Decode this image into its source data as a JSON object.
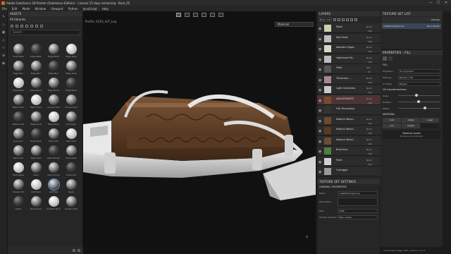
{
  "titlebar": {
    "title": "Adobe Substance 3D Painter (Substance Edition) - License 15 days remaining - Boat_02",
    "minimize": "—",
    "maximize": "☐",
    "close": "✕"
  },
  "menu": [
    "File",
    "Edit",
    "Mode",
    "Window",
    "Viewport",
    "Python",
    "JavaScript",
    "Help"
  ],
  "assets": {
    "panel_title": "ASSETS",
    "library": "All libraries",
    "search_placeholder": "Search",
    "items": [
      "Dust Wide",
      "Edge Bolts",
      "Edge Bolts",
      "Edge Rust",
      "Edge Blur",
      "Edge Blur",
      "Edge Blur",
      "Edge Rust",
      "Edge Bolts",
      "Edge Burnt",
      "Edge Burnt",
      "Edge Bolts",
      "Fabric Thre",
      "Fabric Thre",
      "Ground Dirt",
      "Ground Dirt",
      "Metal Dust",
      "Metal Dust",
      "Moss Sand",
      "Occlusion",
      "Occlusion",
      "Paint Spot",
      "Paint Dirt",
      "Paint Dirt",
      "Paint Dirt",
      "Paint Dirt",
      "Paint Rough",
      "Rust Wide",
      "Sand Wide",
      "Sand",
      "Sand Curve",
      "Scratches",
      "Shape Dirt",
      "Soft Dam",
      "Soft Bed",
      "Spots",
      "Spots",
      "Stone Rock",
      "Surface Rock",
      "Surface Rust",
      "Sand 2D",
      "Water Stain",
      "",
      ""
    ]
  },
  "viewport": {
    "profile": "Profile: ACES_LUT_Log",
    "mode": "Material",
    "axis": "Y"
  },
  "layers": {
    "panel_title": "LAYERS",
    "channel": "Base color",
    "rows": [
      {
        "name": "Mask",
        "blend": "Norm",
        "opacity": "100"
      },
      {
        "name": "Nail Glow",
        "blend": "Norm",
        "opacity": "100"
      },
      {
        "name": "Wooden Edges",
        "blend": "Norm",
        "opacity": "100"
      },
      {
        "name": "Lightened Ed...",
        "blend": "Norm",
        "opacity": "100"
      },
      {
        "name": "Filter",
        "blend": "Mul",
        "opacity": "15"
      },
      {
        "name": "Thickness ...",
        "blend": "Norm",
        "opacity": "100"
      },
      {
        "name": "Light Scratches",
        "blend": "Norm",
        "opacity": "100"
      },
      {
        "name": "ADJUSTMENTS",
        "blend": "Norm",
        "opacity": "100"
      },
      {
        "name": "HSL Perceptive",
        "blend": "",
        "opacity": ""
      },
      {
        "name": "Natural Wood...",
        "blend": "Norm",
        "opacity": "100"
      },
      {
        "name": "Natural Wood...",
        "blend": "Norm",
        "opacity": "100"
      },
      {
        "name": "Natural Wood...",
        "blend": "Norm",
        "opacity": "100"
      },
      {
        "name": "Branches",
        "blend": "Norm",
        "opacity": "100"
      },
      {
        "name": "Paint",
        "blend": "Norm",
        "opacity": "100"
      },
      {
        "name": "Outrigger",
        "blend": "",
        "opacity": ""
      }
    ]
  },
  "texture_set_settings": {
    "panel_title": "TEXTURE SET SETTINGS",
    "section": "GENERAL PROPERTIES",
    "name_label": "Name",
    "name_value": "initialShadingGroup",
    "desc_label": "Description",
    "size_label": "Size",
    "size_value": "4096",
    "shader_label": "Shader instance",
    "shader_value": "Main shader"
  },
  "texture_set_list": {
    "panel_title": "TEXTURE SET LIST",
    "settings": "Settings",
    "row_name": "initialShadingGroup",
    "row_shader": "Main shader"
  },
  "properties": {
    "panel_title": "PROPERTIES - FILL",
    "fill_section": "FILL",
    "projection_label": "Projection",
    "projection_value": "UV projection",
    "filtering_label": "Filtering",
    "filtering_value": "Bilinear | HQ",
    "wrap_label": "UV Wrap",
    "wrap_value": "Repeat",
    "uv_section": "UV transformations",
    "scale_label": "Scale",
    "rotation_label": "Rotation",
    "offset_label": "Offset",
    "material_section": "MATERIAL",
    "mat_buttons": [
      "color",
      "metal",
      "rough",
      "nrm",
      "height",
      ""
    ],
    "mat_mode": "Material mode",
    "mat_resource": "No Resource Selected"
  },
  "status": {
    "text": "Cache Disk Usage: 84% | Version: 7.2.3"
  }
}
